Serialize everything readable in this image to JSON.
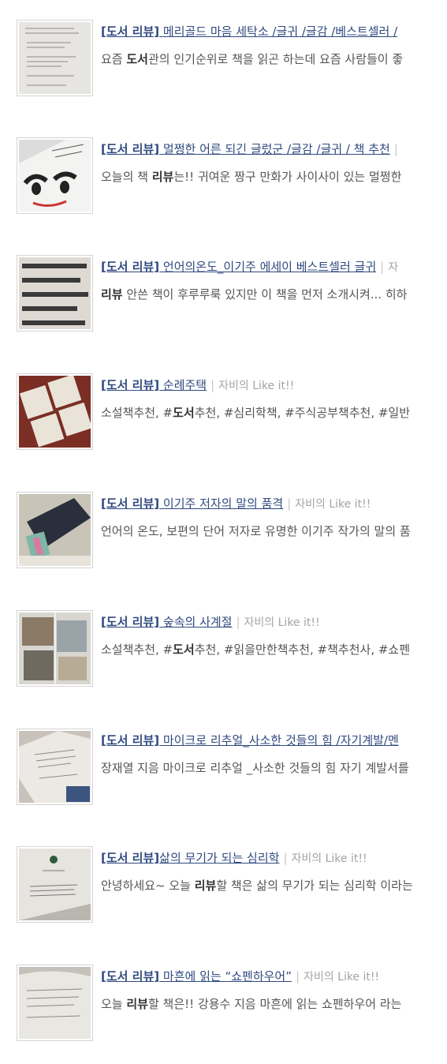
{
  "results": [
    {
      "title_prefix": "[도서 리뷰]",
      "title_rest": " 메리골드 마음 세탁소 /글귀 /글감 /베스트셀러 /",
      "blog": "",
      "snippet": [
        {
          "t": "요즘 ",
          "b": false
        },
        {
          "t": "도서",
          "b": true
        },
        {
          "t": "관의 인기순위로 책을 읽곤 하는데 요즘 사람들이 좋",
          "b": false
        }
      ]
    },
    {
      "title_prefix": "[도서 리뷰]",
      "title_rest": " 멀쩡한 어른 되긴 글렀군 /글감 /글귀 / 책 추천",
      "blog": "",
      "snippet": [
        {
          "t": "오늘의 책 ",
          "b": false
        },
        {
          "t": "리뷰",
          "b": true
        },
        {
          "t": "는!! 귀여운 짱구 만화가 사이사이 있는 멀쩡한",
          "b": false
        }
      ]
    },
    {
      "title_prefix": "[도서 리뷰]",
      "title_rest": " 언어의온도_이기주 에세이 베스트셀러 글귀",
      "blog": "자",
      "snippet": [
        {
          "t": "리뷰",
          "b": true
        },
        {
          "t": " 안쓴 책이 후루루룩 있지만 이 책을 먼저 소개시켜... 히하",
          "b": false
        }
      ]
    },
    {
      "title_prefix": "[도서 리뷰]",
      "title_rest": " 순례주택",
      "blog": "자비의 Like it!!",
      "snippet": [
        {
          "t": "소설책추천, #",
          "b": false
        },
        {
          "t": "도서",
          "b": true
        },
        {
          "t": "추천, #심리학책, #주식공부책추천, #일반",
          "b": false
        }
      ]
    },
    {
      "title_prefix": "[도서 리뷰]",
      "title_rest": " 이기주 저자의 말의 품격",
      "blog": "자비의 Like it!!",
      "snippet": [
        {
          "t": "언어의 온도, 보편의 단어 저자로 유명한 이기주 작가의 말의 품",
          "b": false
        }
      ]
    },
    {
      "title_prefix": "[도서 리뷰]",
      "title_rest": " 숲속의 사계절",
      "blog": "자비의 Like it!!",
      "snippet": [
        {
          "t": "소설책추천, #",
          "b": false
        },
        {
          "t": "도서",
          "b": true
        },
        {
          "t": "추천, #읽을만한책추천, #책추천사, #쇼펜",
          "b": false
        }
      ]
    },
    {
      "title_prefix": "[도서 리뷰]",
      "title_rest": " 마이크로 리추얼_사소한 것들의 힘 /자기계발/멘",
      "blog": "",
      "snippet": [
        {
          "t": "장재열 지음 마이크로 리추얼 _사소한 것들의 힘 자기 계발서를",
          "b": false
        }
      ]
    },
    {
      "title_prefix": "[도서 리뷰]",
      "title_rest": "삶의 무기가 되는 심리학",
      "blog": "자비의 Like it!!",
      "snippet": [
        {
          "t": "안녕하세요~ 오늘 ",
          "b": false
        },
        {
          "t": "리뷰",
          "b": true
        },
        {
          "t": "할 책은 삶의 무기가 되는 심리학 이라는",
          "b": false
        }
      ]
    },
    {
      "title_prefix": "[도서 리뷰]",
      "title_rest": " 마흔에 읽는 “쇼펜하우어”",
      "blog": "자비의 Like it!!",
      "snippet": [
        {
          "t": "오늘 ",
          "b": false
        },
        {
          "t": "리뷰",
          "b": true
        },
        {
          "t": "할 책은!! 강용수 지음 마흔에 읽는 쇼펜하우어 라는",
          "b": false
        }
      ]
    }
  ],
  "thumbnails": [
    {
      "icon": "book-page-thumbnail"
    },
    {
      "icon": "book-cover-face-thumbnail"
    },
    {
      "icon": "book-text-closeup-thumbnail"
    },
    {
      "icon": "book-cover-red-thumbnail"
    },
    {
      "icon": "dark-book-thumbnail"
    },
    {
      "icon": "open-book-photos-thumbnail"
    },
    {
      "icon": "book-pages-thumbnail"
    },
    {
      "icon": "book-title-page-thumbnail"
    },
    {
      "icon": "book-page-curl-thumbnail"
    }
  ],
  "colors": {
    "link": "#304a80",
    "snippet": "#555555",
    "blog": "#a3a3a3"
  }
}
